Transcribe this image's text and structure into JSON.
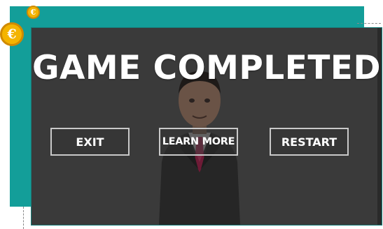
{
  "screen": {
    "title": "GAME COMPLETED"
  },
  "buttons": {
    "exit": "EXIT",
    "learn_more": "LEARN MORE",
    "restart": "RESTART"
  },
  "coins": {
    "symbol": "€",
    "color": "#f4b400"
  },
  "colors": {
    "teal": "#139e99",
    "overlay": "#3a3a3a"
  }
}
